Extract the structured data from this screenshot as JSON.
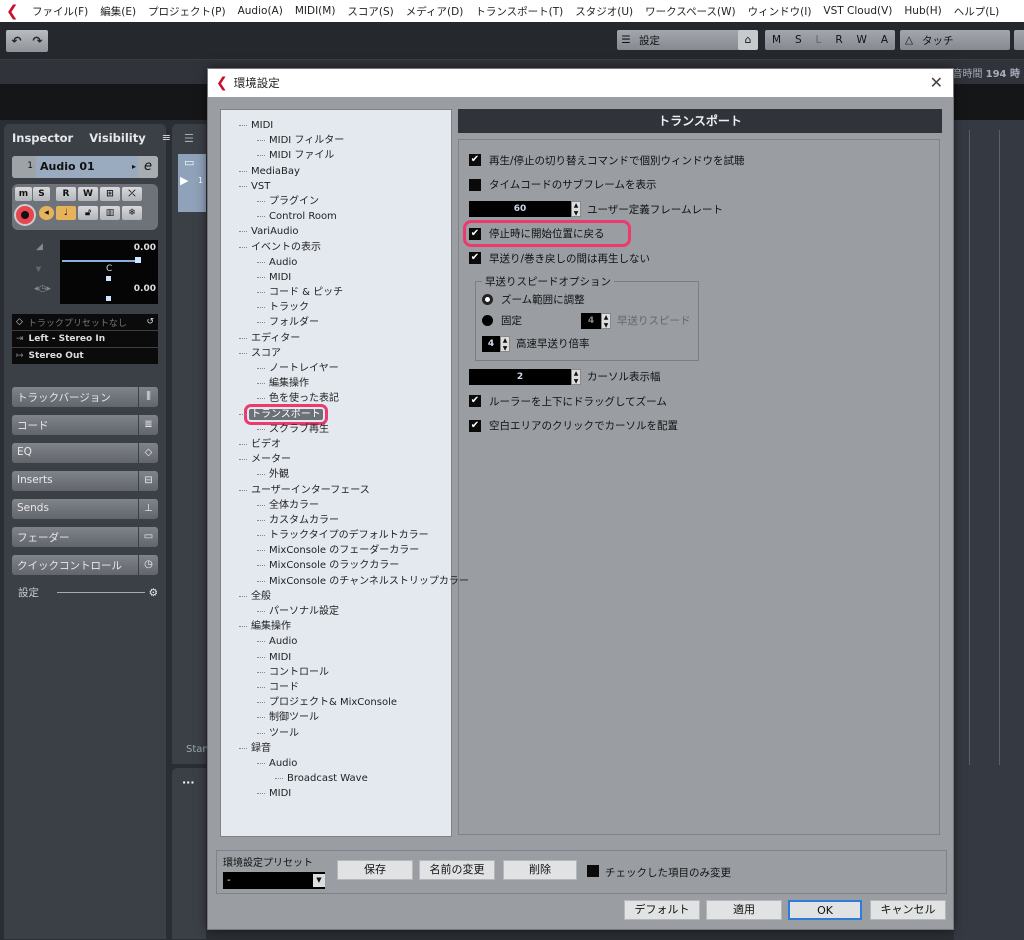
{
  "menubar": {
    "items": [
      "ファイル(F)",
      "編集(E)",
      "プロジェクト(P)",
      "Audio(A)",
      "MIDI(M)",
      "スコア(S)",
      "メディア(D)",
      "トランスポート(T)",
      "スタジオ(U)",
      "ワークスペース(W)",
      "ウィンドウ(I)",
      "VST Cloud(V)",
      "Hub(H)",
      "ヘルプ(L)"
    ]
  },
  "toolbar": {
    "undo_icon": "undo-icon",
    "redo_icon": "redo-icon",
    "settings_label": "設定",
    "automation_modes": [
      "M",
      "S",
      "L",
      "R",
      "W",
      "A"
    ],
    "touch_label": "タッチ",
    "time_remaining_label": "録音時間",
    "time_remaining_value": "194 時"
  },
  "inspector": {
    "tabs": [
      "Inspector",
      "Visibility"
    ],
    "track_number": "1",
    "track_name": "Audio 01",
    "buttons_row1": [
      "m",
      "S",
      "R",
      "W"
    ],
    "volume_value": "0.00",
    "pan_value": "C",
    "delay_value": "0.00",
    "track_preset": "トラックプリセットなし",
    "input_routing": "Left - Stereo In",
    "output_routing": "Stereo Out",
    "sections": [
      {
        "label": "トラックバージョン",
        "icon": "versions-icon",
        "glyph": "⫼"
      },
      {
        "label": "コード",
        "icon": "chord-icon",
        "glyph": "≣"
      },
      {
        "label": "EQ",
        "icon": "eq-icon",
        "glyph": "◇"
      },
      {
        "label": "Inserts",
        "icon": "inserts-icon",
        "glyph": "⊟"
      },
      {
        "label": "Sends",
        "icon": "sends-icon",
        "glyph": "⊥"
      },
      {
        "label": "フェーダー",
        "icon": "fader-icon",
        "glyph": "▭"
      },
      {
        "label": "クイックコントロール",
        "icon": "quick-control-icon",
        "glyph": "◷"
      }
    ],
    "settings_label": "設定"
  },
  "project": {
    "track_number": "1",
    "status_text": "Stan"
  },
  "dialog": {
    "title": "環境設定",
    "tree": [
      {
        "label": "MIDI",
        "level": 0
      },
      {
        "label": "MIDI フィルター",
        "level": 1
      },
      {
        "label": "MIDI ファイル",
        "level": 1
      },
      {
        "label": "MediaBay",
        "level": 0
      },
      {
        "label": "VST",
        "level": 0
      },
      {
        "label": "プラグイン",
        "level": 1
      },
      {
        "label": "Control Room",
        "level": 1
      },
      {
        "label": "VariAudio",
        "level": 0
      },
      {
        "label": "イベントの表示",
        "level": 0
      },
      {
        "label": "Audio",
        "level": 1
      },
      {
        "label": "MIDI",
        "level": 1
      },
      {
        "label": "コード & ピッチ",
        "level": 1
      },
      {
        "label": "トラック",
        "level": 1
      },
      {
        "label": "フォルダー",
        "level": 1
      },
      {
        "label": "エディター",
        "level": 0
      },
      {
        "label": "スコア",
        "level": 0
      },
      {
        "label": "ノートレイヤー",
        "level": 1
      },
      {
        "label": "編集操作",
        "level": 1
      },
      {
        "label": "色を使った表記",
        "level": 1
      },
      {
        "label": "トランスポート",
        "level": 0,
        "selected": true
      },
      {
        "label": "スクラブ再生",
        "level": 1
      },
      {
        "label": "ビデオ",
        "level": 0
      },
      {
        "label": "メーター",
        "level": 0
      },
      {
        "label": "外観",
        "level": 1
      },
      {
        "label": "ユーザーインターフェース",
        "level": 0
      },
      {
        "label": "全体カラー",
        "level": 1
      },
      {
        "label": "カスタムカラー",
        "level": 1
      },
      {
        "label": "トラックタイプのデフォルトカラー",
        "level": 1
      },
      {
        "label": "MixConsole のフェーダーカラー",
        "level": 1
      },
      {
        "label": "MixConsole のラックカラー",
        "level": 1
      },
      {
        "label": "MixConsole のチャンネルストリップカラー",
        "level": 1
      },
      {
        "label": "全般",
        "level": 0
      },
      {
        "label": "パーソナル設定",
        "level": 1
      },
      {
        "label": "編集操作",
        "level": 0
      },
      {
        "label": "Audio",
        "level": 1
      },
      {
        "label": "MIDI",
        "level": 1
      },
      {
        "label": "コントロール",
        "level": 1
      },
      {
        "label": "コード",
        "level": 1
      },
      {
        "label": "プロジェクト& MixConsole",
        "level": 1
      },
      {
        "label": "制御ツール",
        "level": 1
      },
      {
        "label": "ツール",
        "level": 1
      },
      {
        "label": "録音",
        "level": 0
      },
      {
        "label": "Audio",
        "level": 1
      },
      {
        "label": "Broadcast Wave",
        "level": 2
      },
      {
        "label": "MIDI",
        "level": 1
      }
    ],
    "panel_title": "トランスポート",
    "options": {
      "playback_toggle_audition": {
        "label": "再生/停止の切り替えコマンドで個別ウィンドウを試聴",
        "checked": true
      },
      "show_timecode_subframes": {
        "label": "タイムコードのサブフレームを表示",
        "checked": false
      },
      "user_framerate": {
        "label": "ユーザー定義フレームレート",
        "value": "60"
      },
      "return_to_start_on_stop": {
        "label": "停止時に開始位置に戻る",
        "checked": true
      },
      "no_play_while_wind": {
        "label": "早送り/巻き戻しの間は再生しない",
        "checked": true
      },
      "wind_speed_group": {
        "title": "早送りスピードオプション",
        "adjust_to_zoom": {
          "label": "ズーム範囲に調整",
          "selected": false
        },
        "fixed": {
          "label": "固定",
          "selected": true
        },
        "wind_speed": {
          "label": "早送りスピード",
          "value": "4"
        },
        "fast_wind_factor": {
          "label": "高速早送り倍率",
          "value": "4"
        }
      },
      "cursor_width": {
        "label": "カーソル表示幅",
        "value": "2"
      },
      "zoom_by_ruler_drag": {
        "label": "ルーラーを上下にドラッグしてズーム",
        "checked": true
      },
      "click_empty_to_place_cursor": {
        "label": "空白エリアのクリックでカーソルを配置",
        "checked": true
      }
    },
    "preset": {
      "label": "環境設定プリセット",
      "value": "-",
      "save": "保存",
      "rename": "名前の変更",
      "delete": "削除",
      "only_checked_label": "チェックした項目のみ変更",
      "only_checked": false
    },
    "buttons": {
      "default": "デフォルト",
      "apply": "適用",
      "ok": "OK",
      "cancel": "キャンセル"
    }
  },
  "colors": {
    "accent_highlight": "#ec3a6f",
    "brand": "#c8102e",
    "ok_focus": "#2f7bd8"
  }
}
